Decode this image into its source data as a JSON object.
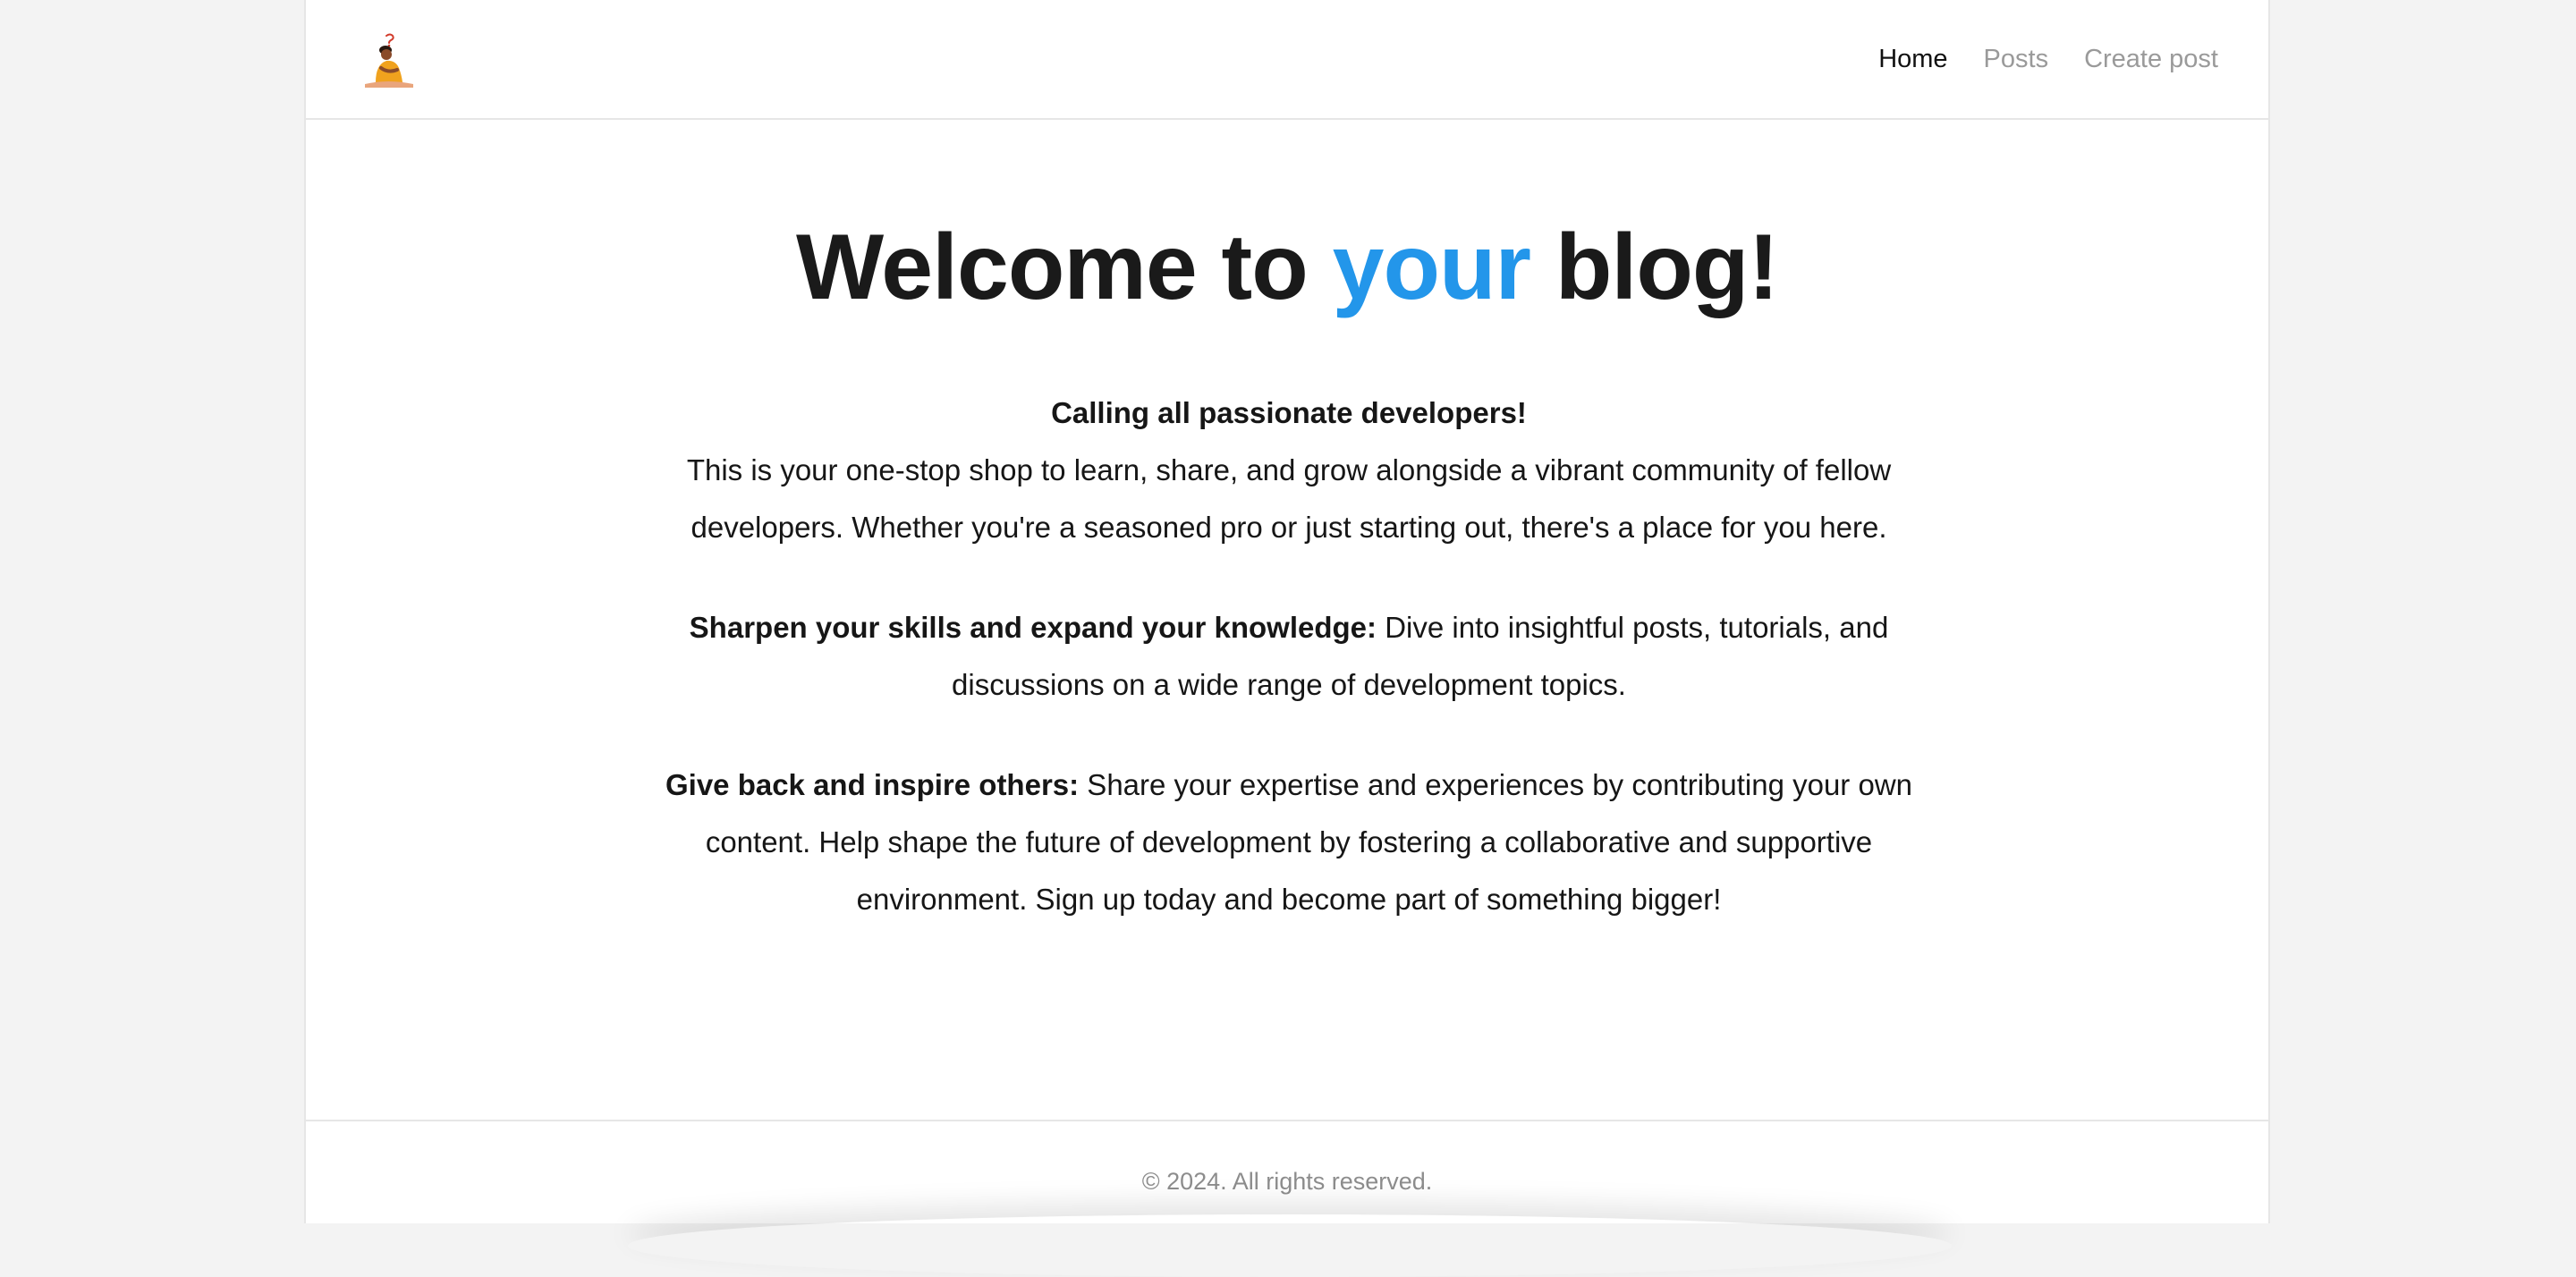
{
  "header": {
    "logo_icon": "person-thinking-icon",
    "nav": {
      "home": "Home",
      "posts": "Posts",
      "create_post": "Create post"
    }
  },
  "hero": {
    "title_before": "Welcome to ",
    "title_accent": "your",
    "title_after": " blog!",
    "accent_color": "#2396ea"
  },
  "content": {
    "intro_heading": "Calling all passionate developers!",
    "intro_text": "This is your one-stop shop to learn, share, and grow alongside a vibrant community of fellow developers. Whether you're a seasoned pro or just starting out, there's a place for you here.",
    "skills_heading": "Sharpen your skills and expand your knowledge:",
    "skills_text": " Dive into insightful posts, tutorials, and discussions on a wide range of development topics.",
    "giveback_heading": "Give back and inspire others:",
    "giveback_text": " Share your expertise and experiences by contributing your own content. Help shape the future of development by fostering a collaborative and supportive environment. Sign up today and become part of something bigger!"
  },
  "footer": {
    "copyright": "© 2024. All rights reserved."
  }
}
